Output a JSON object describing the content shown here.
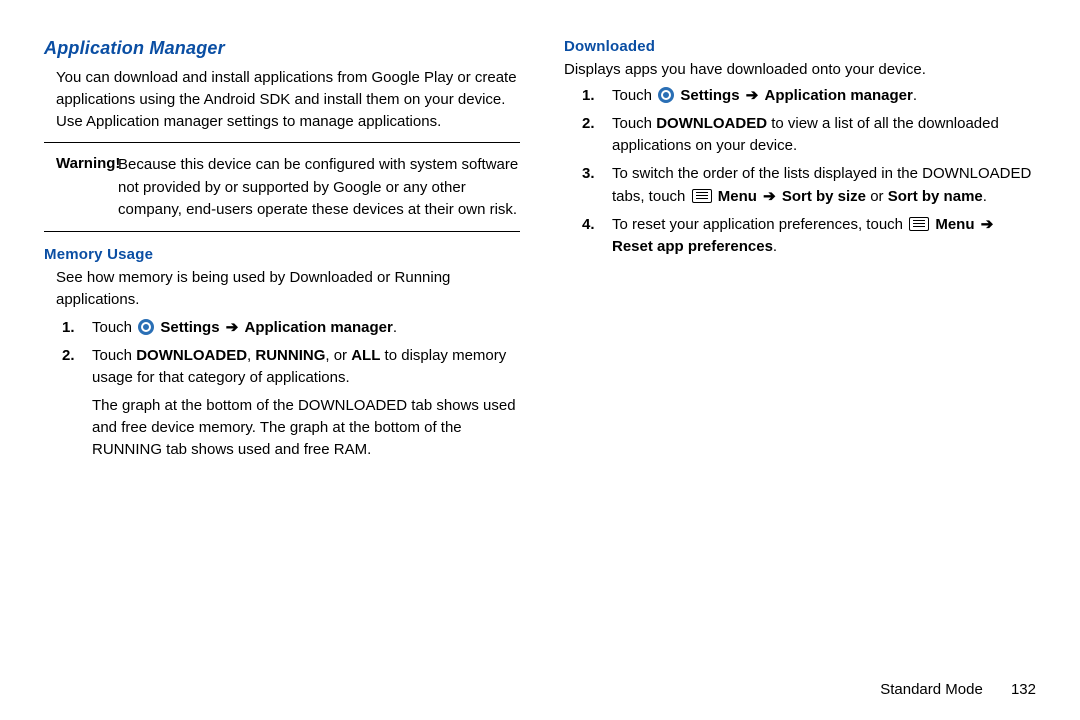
{
  "left": {
    "heading": "Application Manager",
    "intro": "You can download and install applications from Google Play or create applications using the Android SDK and install them on your device. Use Application manager settings to manage applications.",
    "warning_label": "Warning!",
    "warning_body": "Because this device can be configured with system software not provided by or supported by Google or any other company, end-users operate these devices at their own risk.",
    "memory_heading": "Memory Usage",
    "memory_intro": "See how memory is being used by Downloaded or Running applications.",
    "step1_touch": "Touch",
    "step1_path1": "Settings",
    "step1_path2": "Application manager",
    "step2_pre": "Touch ",
    "step2_d": "DOWNLOADED",
    "step2_c1": ", ",
    "step2_r": "RUNNING",
    "step2_c2": ", or ",
    "step2_a": "ALL",
    "step2_post": " to display memory usage for that category of applications.",
    "graph_note": "The graph at the bottom of the DOWNLOADED tab shows used and free device memory. The graph at the bottom of the RUNNING tab shows used and free RAM."
  },
  "right": {
    "heading": "Downloaded",
    "intro": "Displays apps you have downloaded onto your device.",
    "step1_touch": "Touch",
    "step1_path1": "Settings",
    "step1_path2": "Application manager",
    "step2_pre": "Touch ",
    "step2_d": "DOWNLOADED",
    "step2_post": " to view a list of all the downloaded applications on your device.",
    "step3_pre": "To switch the order of the lists displayed in the DOWNLOADED tabs, touch ",
    "step3_menu": "Menu",
    "step3_sort_size": "Sort by size",
    "step3_or": " or ",
    "step3_sort_name": "Sort by name",
    "step4_pre": "To reset your application preferences, touch ",
    "step4_menu": "Menu",
    "step4_reset": "Reset app preferences"
  },
  "sym": {
    "arrow": "➔",
    "period": "."
  },
  "footer": {
    "mode": "Standard Mode",
    "page": "132"
  }
}
